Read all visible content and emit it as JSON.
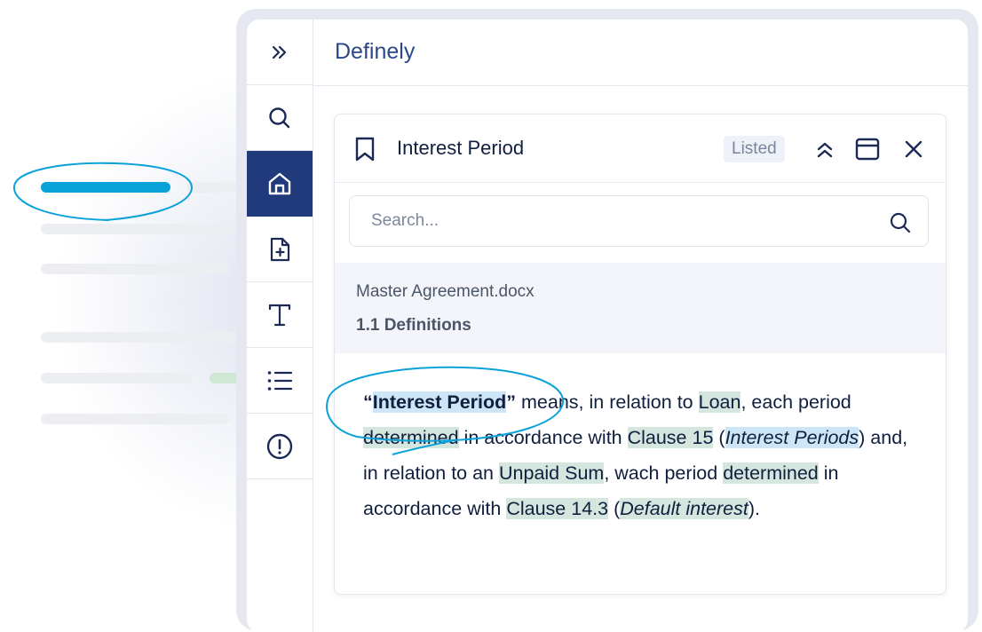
{
  "app": {
    "title": "Definely"
  },
  "rail": {
    "items": [
      {
        "name": "collapse",
        "icon": "chevrons-right-icon"
      },
      {
        "name": "search",
        "icon": "search-icon"
      },
      {
        "name": "home",
        "icon": "home-icon",
        "active": true
      },
      {
        "name": "add-document",
        "icon": "file-plus-icon"
      },
      {
        "name": "text",
        "icon": "text-icon"
      },
      {
        "name": "list",
        "icon": "list-icon"
      },
      {
        "name": "alerts",
        "icon": "alert-circle-icon"
      }
    ]
  },
  "card": {
    "title": "Interest Period",
    "badge": "Listed",
    "search_placeholder": "Search...",
    "source_document": "Master Agreement.docx",
    "source_section": "1.1 Definitions",
    "definition": {
      "open_quote": "“",
      "term": "Interest Period",
      "close_quote": "”",
      "p1": " means, in relation to ",
      "loan": "Loan",
      "p2": ", each period ",
      "determined1": "determined",
      "p3": " in accordance with ",
      "clause15": "Clause 15",
      "p4": " (",
      "interest_periods_a": "Interest Periods",
      "p5": ") and, in relation to an ",
      "unpaid_sum": "Unpaid Sum",
      "p6": ", wach period ",
      "determined2": "determined",
      "p7": " in accordance with ",
      "clause143": "Clause 14.3",
      "p8": " (",
      "default_interest": "Default interest",
      "p9": ")."
    }
  },
  "colors": {
    "rail_active": "#213a7c",
    "brand_title": "#2b4889",
    "annotation": "#0ba1d9",
    "highlight_green": "#d5e6de",
    "highlight_blue": "#cde6f7"
  }
}
